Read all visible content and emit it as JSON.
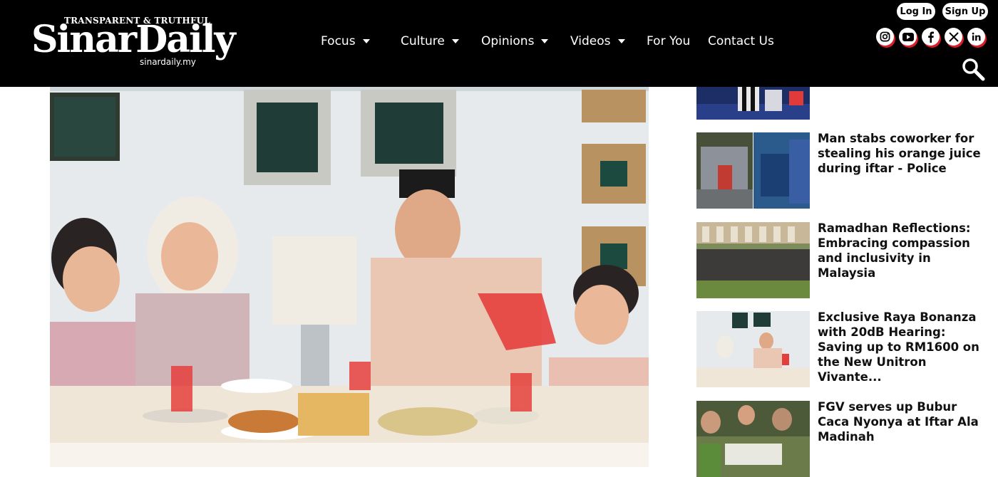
{
  "brand": {
    "tagline": "TRANSPARENT & TRUTHFUL",
    "name": "SinarDaily",
    "domain": "sinardaily.my"
  },
  "nav": [
    {
      "label": "Focus",
      "dropdown": true
    },
    {
      "label": "Culture",
      "dropdown": true
    },
    {
      "label": "Opinions",
      "dropdown": true
    },
    {
      "label": "Videos",
      "dropdown": true
    },
    {
      "label": "For You",
      "dropdown": false
    },
    {
      "label": "Contact Us",
      "dropdown": false
    }
  ],
  "auth": {
    "login": "Log In",
    "signup": "Sign Up"
  },
  "socials": [
    "instagram-icon",
    "youtube-icon",
    "facebook-icon",
    "x-icon",
    "linkedin-icon"
  ],
  "colors": {
    "header_bg": "#000000",
    "accent": "#d61f26",
    "text": "#111111"
  },
  "sidebar": {
    "articles": [
      {
        "title": "Man stabs coworker for stealing his orange juice during iftar - Police"
      },
      {
        "title": "Ramadhan Reflections: Embracing compassion and inclusivity in Malaysia"
      },
      {
        "title": "Exclusive Raya Bonanza with 20dB Hearing: Saving up to RM1600 on the New Unitron Vivante..."
      },
      {
        "title": "FGV serves up Bubur Caca Nyonya at Iftar Ala Madinah"
      }
    ]
  }
}
